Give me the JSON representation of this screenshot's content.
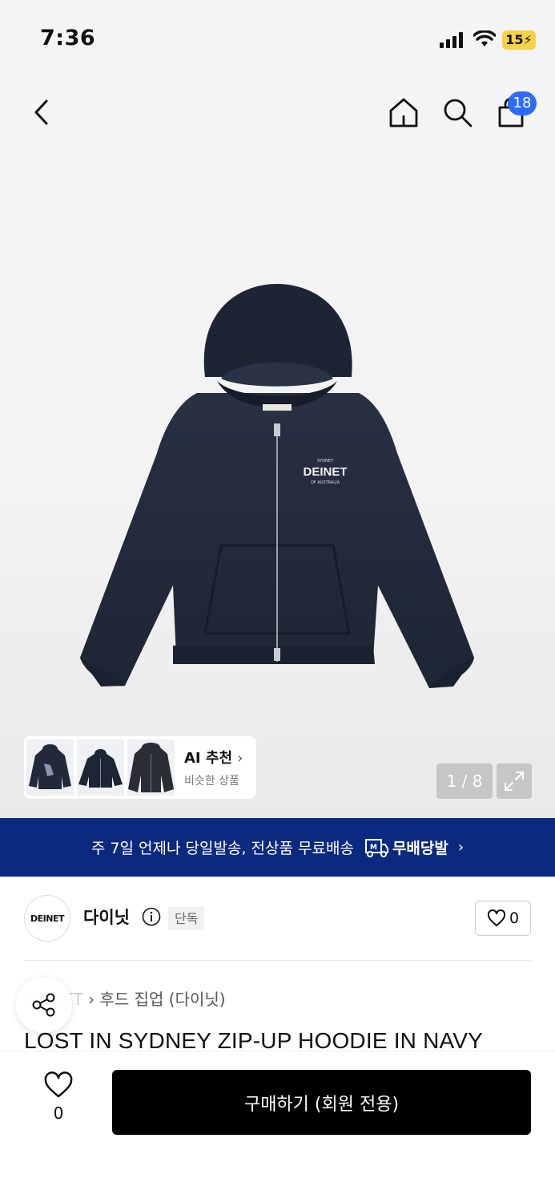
{
  "status_bar": {
    "time": "7:36",
    "battery": "15"
  },
  "nav": {
    "cart_count": "18",
    "icons": [
      "back-icon",
      "home-icon",
      "search-icon",
      "cart-icon"
    ]
  },
  "gallery": {
    "ai_title": "AI 추천",
    "ai_subtitle": "비슷한 상품",
    "page_indicator": "1 / 8",
    "print_brand": "DEINET"
  },
  "banner": {
    "text": "주 7일 언제나 당일발송, 전상품 무료배송",
    "service": "무배당발",
    "badge_letter": "M"
  },
  "brand": {
    "logo_text": "DEINET",
    "name": "다이닛",
    "tag": "단독",
    "like_count": "0"
  },
  "breadcrumb": {
    "prefix": "DEINET",
    "category": "후드 집업 (다이닛)"
  },
  "product": {
    "title": "LOST IN SYDNEY ZIP-UP HOODIE IN NAVY"
  },
  "bottom_bar": {
    "wish_count": "0",
    "buy_label": "구매하기 (회원 전용)"
  },
  "colors": {
    "banner_bg": "#0b2a7f",
    "badge": "#2b6bff",
    "hoodie": "#222a3a"
  }
}
